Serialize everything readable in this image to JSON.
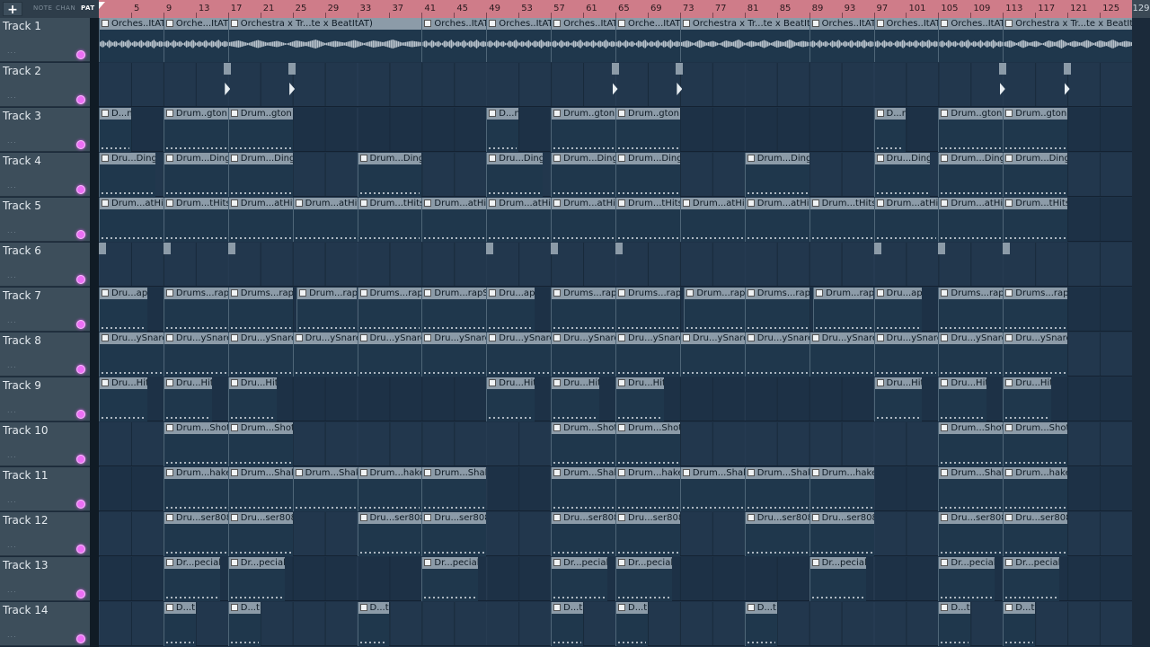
{
  "toolbar": {
    "add_label": "+",
    "modes": [
      "NOTE",
      "CHAN",
      "PAT"
    ],
    "active_mode": "PAT"
  },
  "ruler": {
    "bars": [
      "5",
      "9",
      "13",
      "17",
      "21",
      "25",
      "29",
      "33",
      "37",
      "41",
      "45",
      "49",
      "53",
      "57",
      "61",
      "65",
      "69",
      "73",
      "77",
      "81",
      "85",
      "89",
      "93",
      "97",
      "101",
      "105",
      "109",
      "113",
      "117",
      "121",
      "125"
    ],
    "end_label": "129"
  },
  "tracks": [
    {
      "name": "Track 1",
      "dots": "...",
      "clips": [
        {
          "s": 1,
          "e": 9,
          "label": "Orches..ItAT)",
          "audio": true
        },
        {
          "s": 9,
          "e": 17,
          "label": "Orche...ItAT)",
          "audio": true
        },
        {
          "s": 17,
          "e": 41,
          "label": "Orchestra x Tr...te x BeatItAT)",
          "audio": true
        },
        {
          "s": 41,
          "e": 49,
          "label": "Orches..ItAT)",
          "audio": true
        },
        {
          "s": 49,
          "e": 57,
          "label": "Orches..ItAT)",
          "audio": true
        },
        {
          "s": 57,
          "e": 65,
          "label": "Orches..ItAT)",
          "audio": true
        },
        {
          "s": 65,
          "e": 73,
          "label": "Orche...ItAT)",
          "audio": true
        },
        {
          "s": 73,
          "e": 89,
          "label": "Orchestra x Tr...te x BeatItAT)",
          "audio": true
        },
        {
          "s": 89,
          "e": 97,
          "label": "Orches..ItAT)",
          "audio": true
        },
        {
          "s": 97,
          "e": 105,
          "label": "Orches..ItAT)",
          "audio": true
        },
        {
          "s": 105,
          "e": 113,
          "label": "Orches..ItAT)",
          "audio": true
        },
        {
          "s": 113,
          "e": 129,
          "label": "Orchestra x Tr...te x BeatItAT)",
          "audio": true
        }
      ]
    },
    {
      "name": "Track 2",
      "dots": "...",
      "clips": [
        {
          "s": 16.5,
          "e": 17.5,
          "label": "",
          "tiny": true
        },
        {
          "s": 24.5,
          "e": 25.5,
          "label": "",
          "tiny": true
        },
        {
          "s": 64.5,
          "e": 65.5,
          "label": "",
          "tiny": true
        },
        {
          "s": 72.5,
          "e": 73.5,
          "label": "",
          "tiny": true
        },
        {
          "s": 112.5,
          "e": 113.5,
          "label": "",
          "tiny": true
        },
        {
          "s": 120.5,
          "e": 121.5,
          "label": "",
          "tiny": true
        }
      ]
    },
    {
      "name": "Track 3",
      "dots": "...",
      "clips": [
        {
          "s": 1,
          "e": 5,
          "label": "D...n"
        },
        {
          "s": 9,
          "e": 17,
          "label": "Drum..gton"
        },
        {
          "s": 17,
          "e": 25,
          "label": "Drum..gton"
        },
        {
          "s": 49,
          "e": 53,
          "label": "D...n"
        },
        {
          "s": 57,
          "e": 65,
          "label": "Drum..gton"
        },
        {
          "s": 65,
          "e": 73,
          "label": "Drum..gton"
        },
        {
          "s": 97,
          "e": 101,
          "label": "D...n"
        },
        {
          "s": 105,
          "e": 113,
          "label": "Drum..gton"
        },
        {
          "s": 113,
          "e": 121,
          "label": "Drum..gton"
        }
      ]
    },
    {
      "name": "Track 4",
      "dots": "...",
      "clips": [
        {
          "s": 1,
          "e": 8,
          "label": "Dru...Ding"
        },
        {
          "s": 9,
          "e": 17,
          "label": "Drum...Ding"
        },
        {
          "s": 17,
          "e": 25,
          "label": "Drum...Ding"
        },
        {
          "s": 33,
          "e": 41,
          "label": "Drum...Ding"
        },
        {
          "s": 49,
          "e": 56,
          "label": "Dru...Ding"
        },
        {
          "s": 57,
          "e": 65,
          "label": "Drum...Ding"
        },
        {
          "s": 65,
          "e": 73,
          "label": "Drum...Ding"
        },
        {
          "s": 81,
          "e": 89,
          "label": "Drum...Ding"
        },
        {
          "s": 97,
          "e": 104,
          "label": "Dru...Ding"
        },
        {
          "s": 105,
          "e": 113,
          "label": "Drum...Ding"
        },
        {
          "s": 113,
          "e": 121,
          "label": "Drum...Ding"
        }
      ]
    },
    {
      "name": "Track 5",
      "dots": "...",
      "clips": [
        {
          "s": 1,
          "e": 9,
          "label": "Drum...atHits"
        },
        {
          "s": 9,
          "e": 17,
          "label": "Drum...tHits"
        },
        {
          "s": 17,
          "e": 25,
          "label": "Drum...atHits"
        },
        {
          "s": 25,
          "e": 33,
          "label": "Drum...atHits"
        },
        {
          "s": 33,
          "e": 41,
          "label": "Drum...tHits"
        },
        {
          "s": 41,
          "e": 49,
          "label": "Drum...atHits"
        },
        {
          "s": 49,
          "e": 57,
          "label": "Drum...atHits"
        },
        {
          "s": 57,
          "e": 65,
          "label": "Drum...atHits"
        },
        {
          "s": 65,
          "e": 73,
          "label": "Drum...tHits"
        },
        {
          "s": 73,
          "e": 81,
          "label": "Drum...atHits"
        },
        {
          "s": 81,
          "e": 89,
          "label": "Drum...atHits"
        },
        {
          "s": 89,
          "e": 97,
          "label": "Drum...tHits"
        },
        {
          "s": 97,
          "e": 105,
          "label": "Drum...atHits"
        },
        {
          "s": 105,
          "e": 113,
          "label": "Drum...atHits"
        },
        {
          "s": 113,
          "e": 121,
          "label": "Drum...tHits"
        }
      ]
    },
    {
      "name": "Track 6",
      "dots": "...",
      "clips": [
        {
          "s": 1,
          "e": 2,
          "label": "",
          "tiny2": true
        },
        {
          "s": 9,
          "e": 10,
          "label": "",
          "tiny2": true
        },
        {
          "s": 17,
          "e": 18,
          "label": "",
          "tiny2": true
        },
        {
          "s": 49,
          "e": 50,
          "label": "",
          "tiny2": true
        },
        {
          "s": 57,
          "e": 58,
          "label": "",
          "tiny2": true
        },
        {
          "s": 65,
          "e": 66,
          "label": "",
          "tiny2": true
        },
        {
          "s": 97,
          "e": 98,
          "label": "",
          "tiny2": true
        },
        {
          "s": 105,
          "e": 106,
          "label": "",
          "tiny2": true
        },
        {
          "s": 113,
          "e": 114,
          "label": "",
          "tiny2": true
        }
      ]
    },
    {
      "name": "Track 7",
      "dots": "...",
      "clips": [
        {
          "s": 1,
          "e": 7,
          "label": "Dru...apS"
        },
        {
          "s": 9,
          "e": 17,
          "label": "Drums...rapS"
        },
        {
          "s": 17,
          "e": 25,
          "label": "Drums...rapS"
        },
        {
          "s": 25.5,
          "e": 33,
          "label": "Drum...rapS"
        },
        {
          "s": 33,
          "e": 41,
          "label": "Drums...rapS"
        },
        {
          "s": 41,
          "e": 49,
          "label": "Drum...rapS"
        },
        {
          "s": 49,
          "e": 55,
          "label": "Dru...apS"
        },
        {
          "s": 57,
          "e": 65,
          "label": "Drums...rapS"
        },
        {
          "s": 65,
          "e": 73,
          "label": "Drums...rapS"
        },
        {
          "s": 73.5,
          "e": 81,
          "label": "Drum...rapS"
        },
        {
          "s": 81,
          "e": 89,
          "label": "Drums...rapS"
        },
        {
          "s": 89.5,
          "e": 97,
          "label": "Drum...rapS"
        },
        {
          "s": 97,
          "e": 103,
          "label": "Dru...apS"
        },
        {
          "s": 105,
          "e": 113,
          "label": "Drums...rapS"
        },
        {
          "s": 113,
          "e": 121,
          "label": "Drums...rapS"
        }
      ]
    },
    {
      "name": "Track 8",
      "dots": "...",
      "clips": [
        {
          "s": 1,
          "e": 9,
          "label": "Dru...ySnare"
        },
        {
          "s": 9,
          "e": 17,
          "label": "Dru...ySnare"
        },
        {
          "s": 17,
          "e": 25,
          "label": "Dru...ySnare"
        },
        {
          "s": 25,
          "e": 33,
          "label": "Dru...ySnare"
        },
        {
          "s": 33,
          "e": 41,
          "label": "Dru...ySnare"
        },
        {
          "s": 41,
          "e": 49,
          "label": "Dru...ySnare"
        },
        {
          "s": 49,
          "e": 57,
          "label": "Dru...ySnare"
        },
        {
          "s": 57,
          "e": 65,
          "label": "Dru...ySnare"
        },
        {
          "s": 65,
          "e": 73,
          "label": "Dru...ySnare"
        },
        {
          "s": 73,
          "e": 81,
          "label": "Dru...ySnare"
        },
        {
          "s": 81,
          "e": 89,
          "label": "Dru...ySnare"
        },
        {
          "s": 89,
          "e": 97,
          "label": "Dru...ySnare"
        },
        {
          "s": 97,
          "e": 105,
          "label": "Dru...ySnare"
        },
        {
          "s": 105,
          "e": 113,
          "label": "Dru...ySnare"
        },
        {
          "s": 113,
          "e": 121,
          "label": "Dru...ySnare"
        }
      ]
    },
    {
      "name": "Track 9",
      "dots": "...",
      "clips": [
        {
          "s": 1,
          "e": 7,
          "label": "Dru...Hit"
        },
        {
          "s": 9,
          "e": 15,
          "label": "Dru...Hit"
        },
        {
          "s": 17,
          "e": 23,
          "label": "Dru...Hit"
        },
        {
          "s": 49,
          "e": 55,
          "label": "Dru...Hit"
        },
        {
          "s": 57,
          "e": 63,
          "label": "Dru...Hit"
        },
        {
          "s": 65,
          "e": 71,
          "label": "Dru...Hit"
        },
        {
          "s": 97,
          "e": 103,
          "label": "Dru...Hit"
        },
        {
          "s": 105,
          "e": 111,
          "label": "Dru...Hit"
        },
        {
          "s": 113,
          "e": 119,
          "label": "Dru...Hit"
        }
      ]
    },
    {
      "name": "Track 10",
      "dots": "...",
      "clips": [
        {
          "s": 9,
          "e": 17,
          "label": "Drum...Shot"
        },
        {
          "s": 17,
          "e": 25,
          "label": "Drum...Shot"
        },
        {
          "s": 57,
          "e": 65,
          "label": "Drum...Shot"
        },
        {
          "s": 65,
          "e": 73,
          "label": "Drum...Shot"
        },
        {
          "s": 105,
          "e": 113,
          "label": "Drum...Shot"
        },
        {
          "s": 113,
          "e": 121,
          "label": "Drum...Shot"
        }
      ]
    },
    {
      "name": "Track 11",
      "dots": "...",
      "clips": [
        {
          "s": 9,
          "e": 17,
          "label": "Drum...hake"
        },
        {
          "s": 17,
          "e": 25,
          "label": "Drum...Shake"
        },
        {
          "s": 25,
          "e": 33,
          "label": "Drum...Shake"
        },
        {
          "s": 33,
          "e": 41,
          "label": "Drum...hake"
        },
        {
          "s": 41,
          "e": 49,
          "label": "Drum...Shake"
        },
        {
          "s": 57,
          "e": 65,
          "label": "Drum...Shake"
        },
        {
          "s": 65,
          "e": 73,
          "label": "Drum...hake"
        },
        {
          "s": 73,
          "e": 81,
          "label": "Drum...Shake"
        },
        {
          "s": 81,
          "e": 89,
          "label": "Drum...Shake"
        },
        {
          "s": 89,
          "e": 97,
          "label": "Drum...hake"
        },
        {
          "s": 105,
          "e": 113,
          "label": "Drum...Shake"
        },
        {
          "s": 113,
          "e": 121,
          "label": "Drum...hake"
        }
      ]
    },
    {
      "name": "Track 12",
      "dots": "...",
      "clips": [
        {
          "s": 9,
          "e": 17,
          "label": "Dru...ser808"
        },
        {
          "s": 17,
          "e": 25,
          "label": "Dru...ser808"
        },
        {
          "s": 33,
          "e": 41,
          "label": "Dru...ser808"
        },
        {
          "s": 41,
          "e": 49,
          "label": "Dru...ser808"
        },
        {
          "s": 57,
          "e": 65,
          "label": "Dru...ser808"
        },
        {
          "s": 65,
          "e": 73,
          "label": "Dru...ser808"
        },
        {
          "s": 81,
          "e": 89,
          "label": "Dru...ser808"
        },
        {
          "s": 89,
          "e": 97,
          "label": "Dru...ser808"
        },
        {
          "s": 105,
          "e": 113,
          "label": "Dru...ser808"
        },
        {
          "s": 113,
          "e": 121,
          "label": "Dru...ser808"
        }
      ]
    },
    {
      "name": "Track 13",
      "dots": "...",
      "clips": [
        {
          "s": 9,
          "e": 16,
          "label": "Dr...pecial"
        },
        {
          "s": 17,
          "e": 24,
          "label": "Dr...pecial"
        },
        {
          "s": 41,
          "e": 48,
          "label": "Dr...pecial"
        },
        {
          "s": 57,
          "e": 64,
          "label": "Dr...pecial"
        },
        {
          "s": 65,
          "e": 72,
          "label": "Dr...pecial"
        },
        {
          "s": 89,
          "e": 96,
          "label": "Dr...pecial"
        },
        {
          "s": 105,
          "e": 112,
          "label": "Dr...pecial"
        },
        {
          "s": 113,
          "e": 120,
          "label": "Dr...pecial"
        }
      ]
    },
    {
      "name": "Track 14",
      "dots": "...",
      "clips": [
        {
          "s": 9,
          "e": 13,
          "label": "D...t"
        },
        {
          "s": 17,
          "e": 21,
          "label": "D...t"
        },
        {
          "s": 33,
          "e": 37,
          "label": "D...t"
        },
        {
          "s": 57,
          "e": 61,
          "label": "D...t"
        },
        {
          "s": 65,
          "e": 69,
          "label": "D...t"
        },
        {
          "s": 81,
          "e": 85,
          "label": "D...t"
        },
        {
          "s": 105,
          "e": 109,
          "label": "D...t"
        },
        {
          "s": 113,
          "e": 117,
          "label": "D...t"
        }
      ]
    }
  ]
}
